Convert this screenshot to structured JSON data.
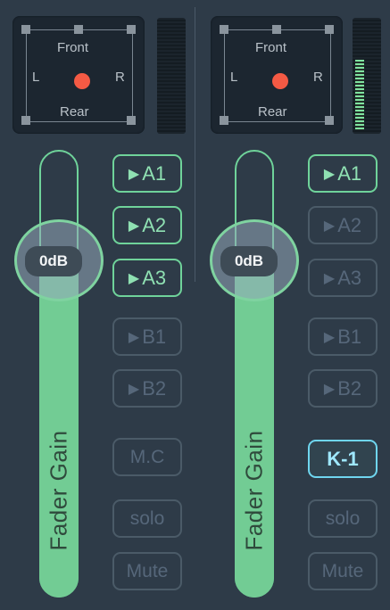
{
  "strips": [
    {
      "pan": {
        "front": "Front",
        "rear": "Rear",
        "left": "L",
        "right": "R"
      },
      "meter_level": 0.0,
      "fader": {
        "value_label": "0dB",
        "name": "Fader Gain",
        "level": 0.76
      },
      "buttons": {
        "a1": {
          "label": "A1",
          "active": true
        },
        "a2": {
          "label": "A2",
          "active": true
        },
        "a3": {
          "label": "A3",
          "active": true
        },
        "b1": {
          "label": "B1",
          "active": false
        },
        "b2": {
          "label": "B2",
          "active": false
        },
        "mc": {
          "label": "M.C",
          "active": false
        },
        "solo": {
          "label": "solo",
          "active": false
        },
        "mute": {
          "label": "Mute",
          "active": false
        }
      }
    },
    {
      "pan": {
        "front": "Front",
        "rear": "Rear",
        "left": "L",
        "right": "R"
      },
      "meter_level": 0.65,
      "fader": {
        "value_label": "0dB",
        "name": "Fader Gain",
        "level": 0.76
      },
      "buttons": {
        "a1": {
          "label": "A1",
          "active": true
        },
        "a2": {
          "label": "A2",
          "active": false
        },
        "a3": {
          "label": "A3",
          "active": false
        },
        "b1": {
          "label": "B1",
          "active": false
        },
        "b2": {
          "label": "B2",
          "active": false
        },
        "k1": {
          "label": "K-1",
          "active": true
        },
        "solo": {
          "label": "solo",
          "active": false
        },
        "mute": {
          "label": "Mute",
          "active": false
        }
      }
    }
  ],
  "colors": {
    "background": "#2e3b48",
    "accent_green": "#6fd39a",
    "accent_cyan": "#6fd6ef",
    "pan_dot": "#f45a44"
  }
}
